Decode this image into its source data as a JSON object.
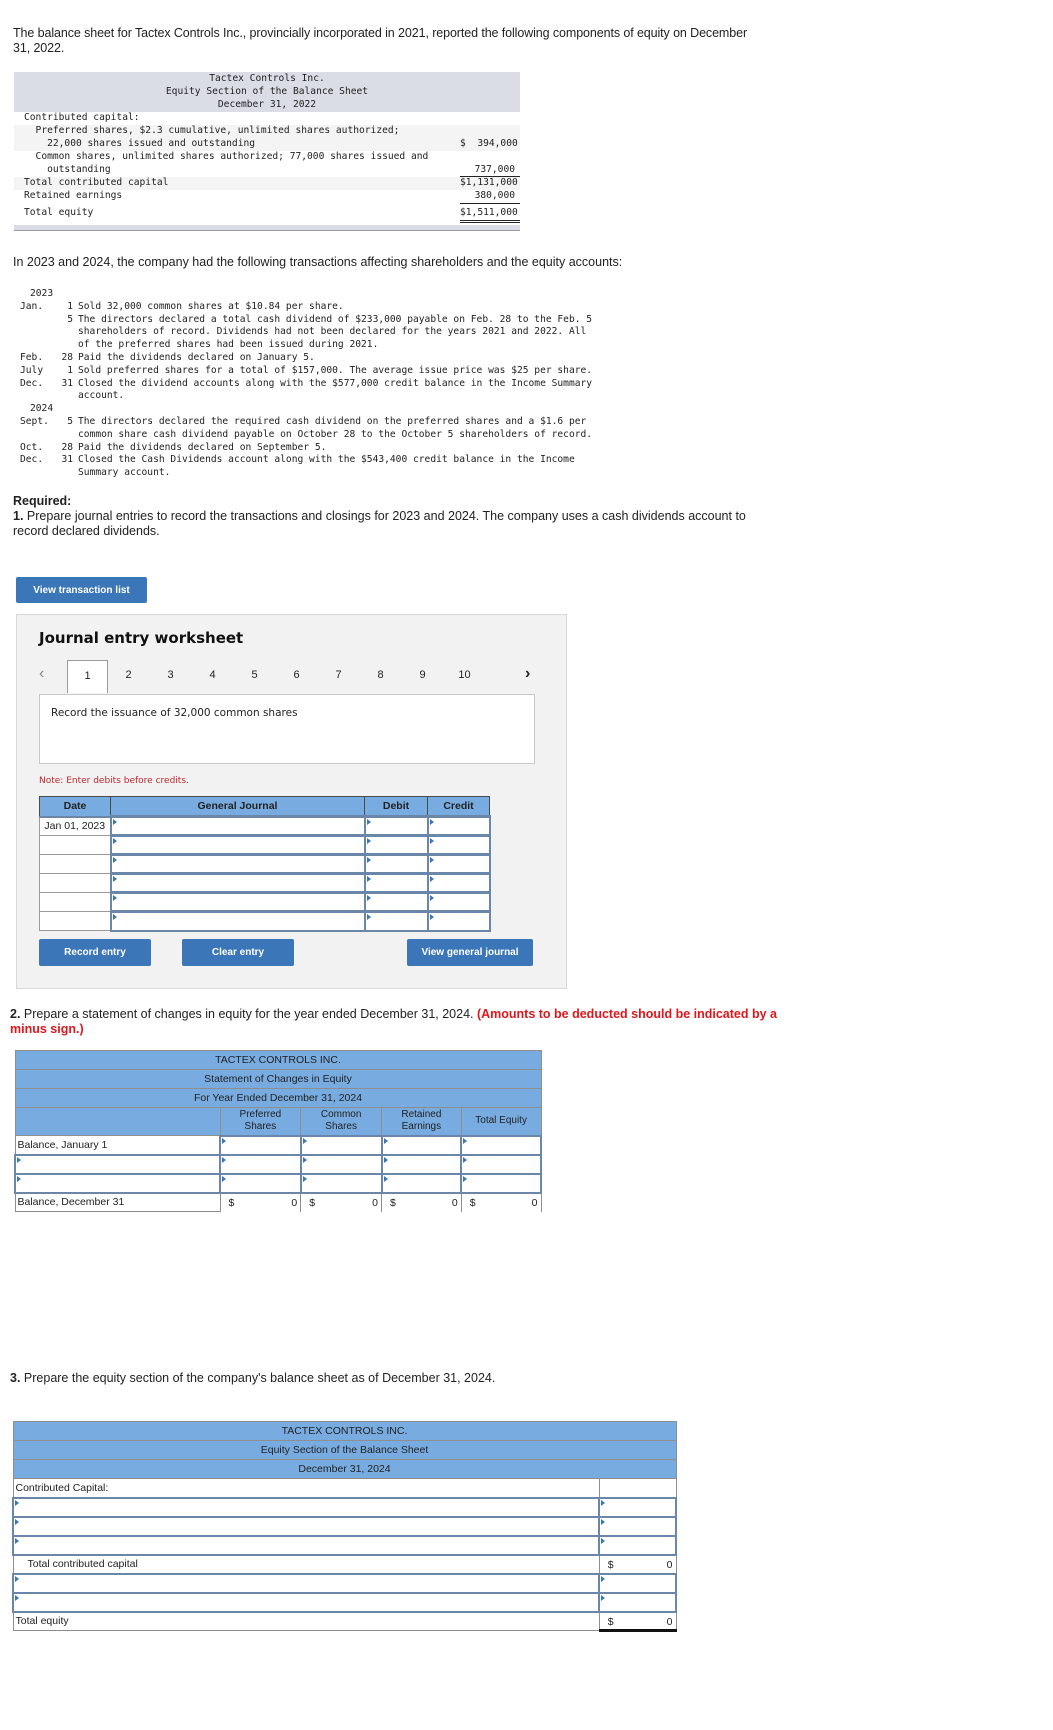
{
  "intro": "The balance sheet for Tactex Controls Inc., provincially incorporated in 2021, reported the following components of equity on December 31, 2022.",
  "equity_2022": {
    "header": [
      "Tactex Controls Inc.",
      "Equity Section of the Balance Sheet",
      "December 31, 2022"
    ],
    "rows": [
      {
        "label": "Contributed capital:",
        "amount": ""
      },
      {
        "label": "  Preferred shares, $2.3 cumulative, unlimited shares authorized;",
        "amount": ""
      },
      {
        "label": "    22,000 shares issued and outstanding",
        "amount": "$  394,000"
      },
      {
        "label": "  Common shares, unlimited shares authorized; 77,000 shares issued and",
        "amount": ""
      },
      {
        "label": "    outstanding",
        "amount": "737,000"
      },
      {
        "label": "Total contributed capital",
        "amount": "$1,131,000"
      },
      {
        "label": "Retained earnings",
        "amount": "380,000"
      },
      {
        "label": "Total equity",
        "amount": "$1,511,000"
      }
    ]
  },
  "transactions_intro": "In 2023 and 2024, the company had the following transactions affecting shareholders and the equity accounts:",
  "transactions": [
    {
      "year": "2023"
    },
    {
      "month": "Jan.",
      "day": "1",
      "text": "Sold 32,000 common shares at $10.84 per share."
    },
    {
      "month": "",
      "day": "5",
      "text": "The directors declared a total cash dividend of $233,000 payable on Feb. 28 to the Feb. 5\nshareholders of record. Dividends had not been declared for the years 2021 and 2022. All\nof the preferred shares had been issued during 2021."
    },
    {
      "month": "Feb.",
      "day": "28",
      "text": "Paid the dividends declared on January 5."
    },
    {
      "month": "July",
      "day": "1",
      "text": "Sold preferred shares for a total of $157,000. The average issue price was $25 per share."
    },
    {
      "month": "Dec.",
      "day": "31",
      "text": "Closed the dividend accounts along with the $577,000 credit balance in the Income Summary\naccount."
    },
    {
      "year": "2024"
    },
    {
      "month": "Sept.",
      "day": "5",
      "text": "The directors declared the required cash dividend on the preferred shares and a $1.6 per\ncommon share cash dividend payable on October 28 to the October 5 shareholders of record."
    },
    {
      "month": "Oct.",
      "day": "28",
      "text": "Paid the dividends declared on September 5."
    },
    {
      "month": "Dec.",
      "day": "31",
      "text": "Closed the Cash Dividends account along with the $543,400 credit balance in the Income\nSummary account."
    }
  ],
  "required": {
    "heading": "Required:",
    "part1_num": "1.",
    "part1_text": " Prepare journal entries to record the transactions and closings for 2023 and 2024. The company uses a cash dividends account to record declared dividends."
  },
  "view_transaction_list": "View transaction list",
  "worksheet": {
    "title": "Journal entry worksheet",
    "tabs": [
      "1",
      "2",
      "3",
      "4",
      "5",
      "6",
      "7",
      "8",
      "9",
      "10"
    ],
    "active_tab": "1",
    "prev_icon": "‹",
    "next_icon": "›",
    "description": "Record the issuance of 32,000 common shares",
    "note": "Note: Enter debits before credits.",
    "columns": [
      "Date",
      "General Journal",
      "Debit",
      "Credit"
    ],
    "rows": [
      {
        "date": "Jan 01, 2023",
        "account": "",
        "debit": "",
        "credit": ""
      },
      {
        "date": "",
        "account": "",
        "debit": "",
        "credit": ""
      },
      {
        "date": "",
        "account": "",
        "debit": "",
        "credit": ""
      },
      {
        "date": "",
        "account": "",
        "debit": "",
        "credit": ""
      },
      {
        "date": "",
        "account": "",
        "debit": "",
        "credit": ""
      },
      {
        "date": "",
        "account": "",
        "debit": "",
        "credit": ""
      }
    ],
    "buttons": {
      "record": "Record entry",
      "clear": "Clear entry",
      "view_journal": "View general journal"
    }
  },
  "part2": {
    "num": "2.",
    "text": " Prepare a statement of changes in equity for the year ended December 31, 2024. ",
    "warning": "(Amounts to be deducted should be indicated by a minus sign.)"
  },
  "soce": {
    "header": [
      "TACTEX CONTROLS INC.",
      "Statement of Changes in Equity",
      "For Year Ended December 31, 2024"
    ],
    "columns": [
      "Preferred\nShares",
      "Common\nShares",
      "Retained\nEarnings",
      "Total Equity"
    ],
    "rows": {
      "opening_label": "Balance, January 1",
      "closing_label": "Balance, December 31"
    },
    "currency": "$",
    "closing_values": [
      "0",
      "0",
      "0",
      "0"
    ]
  },
  "part3": {
    "num": "3.",
    "text": " Prepare the equity section of the company's balance sheet as of December 31, 2024."
  },
  "equity_2024": {
    "header": [
      "TACTEX CONTROLS INC.",
      "Equity Section of the Balance Sheet",
      "December 31, 2024"
    ],
    "contributed_label": "Contributed Capital:",
    "total_contributed_label": "Total contributed capital",
    "total_contributed_value": "0",
    "total_equity_label": "Total equity",
    "total_equity_value": "0",
    "currency": "$"
  }
}
